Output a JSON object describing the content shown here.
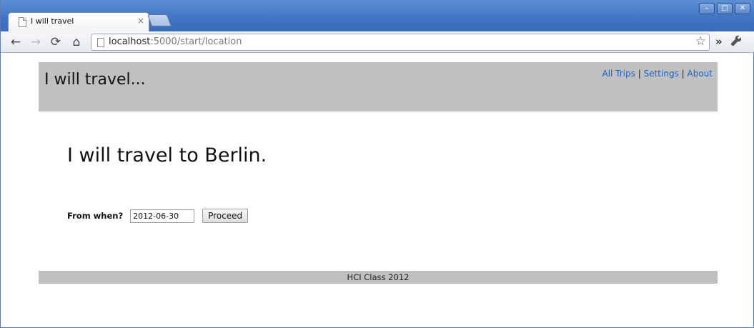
{
  "browser": {
    "tab_title": "I will travel",
    "tab_close": "×",
    "url_host": "localhost",
    "url_rest": ":5000/start/location",
    "window_controls": {
      "minimize": "–",
      "maximize": "□",
      "close": "✕"
    },
    "icons": {
      "back": "←",
      "forward": "→",
      "reload": "⟳",
      "home": "⌂",
      "star": "☆",
      "chevrons": "»",
      "wrench": "🔧"
    }
  },
  "page": {
    "site_title": "I will travel...",
    "nav": {
      "all_trips": "All Trips",
      "separator1": "|",
      "settings": "Settings",
      "separator2": "|",
      "about": "About"
    },
    "heading": "I will travel to Berlin.",
    "form": {
      "label": "From when?",
      "date_value": "2012-06-30",
      "proceed_label": "Proceed"
    },
    "footer": "HCI Class 2012"
  },
  "colors": {
    "header_bg": "#c0c0c0",
    "link": "#1a63c4",
    "titlebar": "#4a7cc8"
  }
}
